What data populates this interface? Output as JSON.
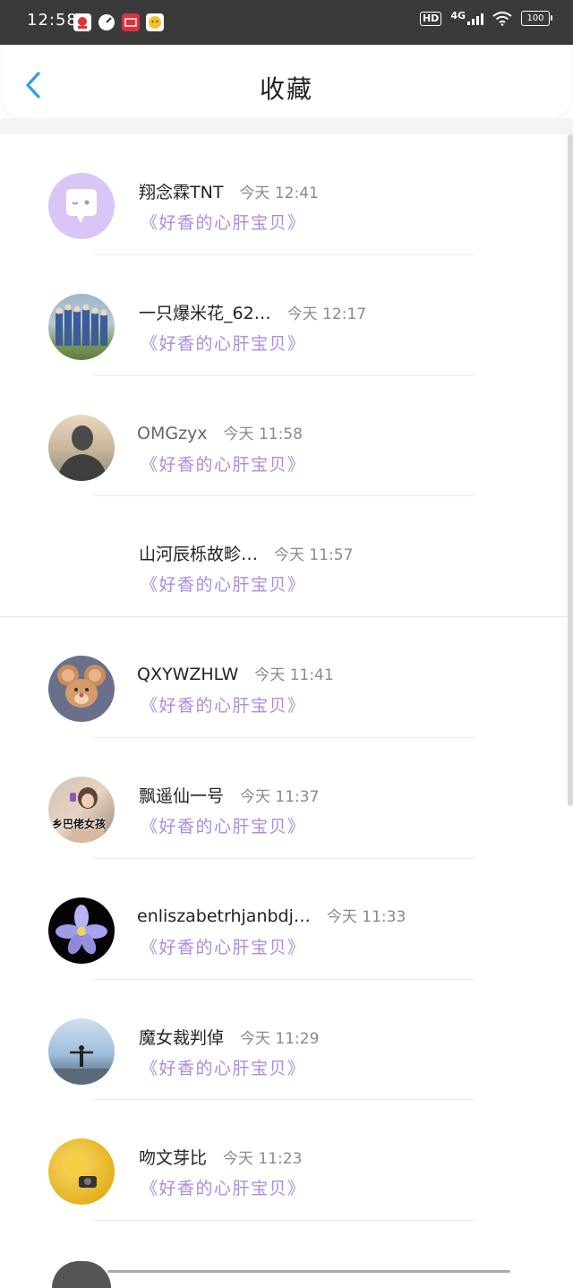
{
  "status_bar": {
    "time": "12:58",
    "hd": "HD",
    "network": "4G",
    "battery": "100"
  },
  "header": {
    "title": "收藏"
  },
  "items": [
    {
      "name": "翔念霖TNT",
      "time": "今天  12:41",
      "link": "《好香的心肝宝贝》",
      "avatar": "ghost-icon"
    },
    {
      "name": "一只爆米花_62…",
      "time": "今天  12:17",
      "link": "《好香的心肝宝贝》",
      "avatar": "group-photo"
    },
    {
      "name": "OMGzyx",
      "time": "今天  11:58",
      "link": "《好香的心肝宝贝》",
      "avatar": "person-photo"
    },
    {
      "name": "山河辰栎故畛…",
      "time": "今天  11:57",
      "link": "《好香的心肝宝贝》",
      "avatar": "none"
    },
    {
      "name": "QXYWZHLW",
      "time": "今天  11:41",
      "link": "《好香的心肝宝贝》",
      "avatar": "cartoon-mouse"
    },
    {
      "name": "飘遥仙一号",
      "time": "今天  11:37",
      "link": "《好香的心肝宝贝》",
      "avatar": "girl-photo",
      "avatar_text": "乡巴佬女孩"
    },
    {
      "name": "enliszabetrhjanbdj…",
      "time": "今天  11:33",
      "link": "《好香的心肝宝贝》",
      "avatar": "iris-flower"
    },
    {
      "name": "魔女裁判倬",
      "time": "今天  11:29",
      "link": "《好香的心肝宝贝》",
      "avatar": "sky-person"
    },
    {
      "name": "吻文芽比",
      "time": "今天  11:23",
      "link": "《好香的心肝宝贝》",
      "avatar": "yellow-flower"
    }
  ],
  "colors": {
    "accent_link": "#a88de0",
    "back_arrow": "#2f9ee8",
    "status_bar": "#3a3a3a"
  }
}
